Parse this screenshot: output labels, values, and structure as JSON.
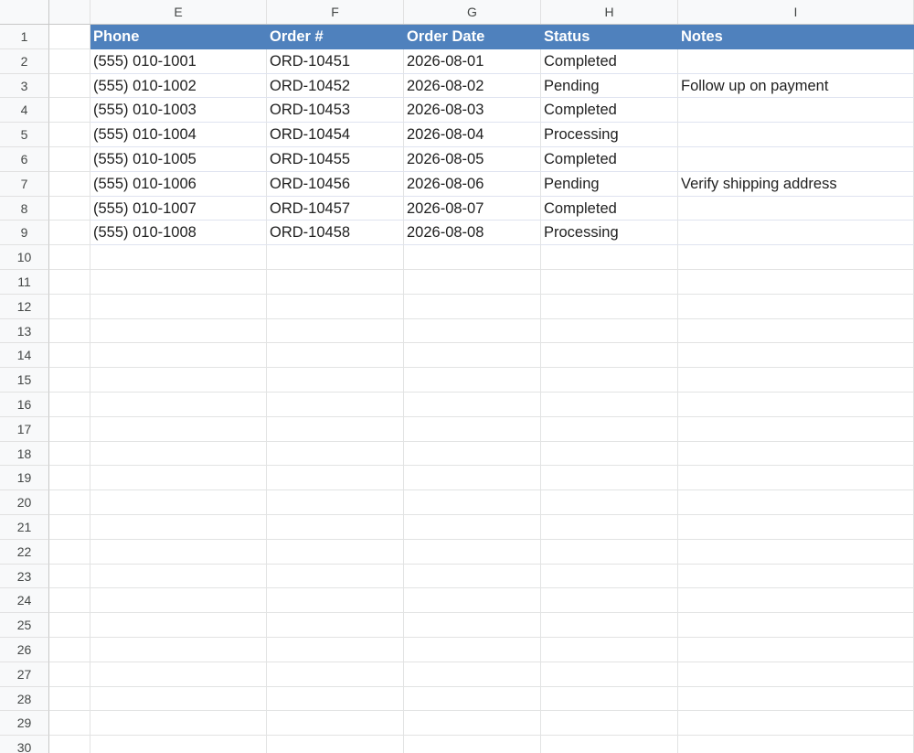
{
  "columns": [
    "E",
    "F",
    "G",
    "H",
    "I"
  ],
  "header": {
    "row_number": "1",
    "cells": [
      "Phone",
      "Order #",
      "Order Date",
      "Status",
      "Notes"
    ]
  },
  "rows": [
    {
      "row_number": "2",
      "phone": "(555) 010-1001",
      "order": "ORD-10451",
      "date": "2026-08-01",
      "status": "Completed",
      "notes": ""
    },
    {
      "row_number": "3",
      "phone": "(555) 010-1002",
      "order": "ORD-10452",
      "date": "2026-08-02",
      "status": "Pending",
      "notes": "Follow up on payment"
    },
    {
      "row_number": "4",
      "phone": "(555) 010-1003",
      "order": "ORD-10453",
      "date": "2026-08-03",
      "status": "Completed",
      "notes": ""
    },
    {
      "row_number": "5",
      "phone": "(555) 010-1004",
      "order": "ORD-10454",
      "date": "2026-08-04",
      "status": "Processing",
      "notes": ""
    },
    {
      "row_number": "6",
      "phone": "(555) 010-1005",
      "order": "ORD-10455",
      "date": "2026-08-05",
      "status": "Completed",
      "notes": ""
    },
    {
      "row_number": "7",
      "phone": "(555) 010-1006",
      "order": "ORD-10456",
      "date": "2026-08-06",
      "status": "Pending",
      "notes": "Verify shipping address"
    },
    {
      "row_number": "8",
      "phone": "(555) 010-1007",
      "order": "ORD-10457",
      "date": "2026-08-07",
      "status": "Completed",
      "notes": ""
    },
    {
      "row_number": "9",
      "phone": "(555) 010-1008",
      "order": "ORD-10458",
      "date": "2026-08-08",
      "status": "Processing",
      "notes": ""
    }
  ],
  "empty_rows": [
    "10",
    "11",
    "12",
    "13",
    "14",
    "15",
    "16",
    "17",
    "18",
    "19",
    "20",
    "21",
    "22",
    "23",
    "24",
    "25",
    "26",
    "27",
    "28",
    "29",
    "30"
  ],
  "colors": {
    "header_fill": "#4f81bd",
    "header_text": "#ffffff",
    "gridline": "#e2e3e3",
    "row_header_bg": "#f8f9fa"
  }
}
